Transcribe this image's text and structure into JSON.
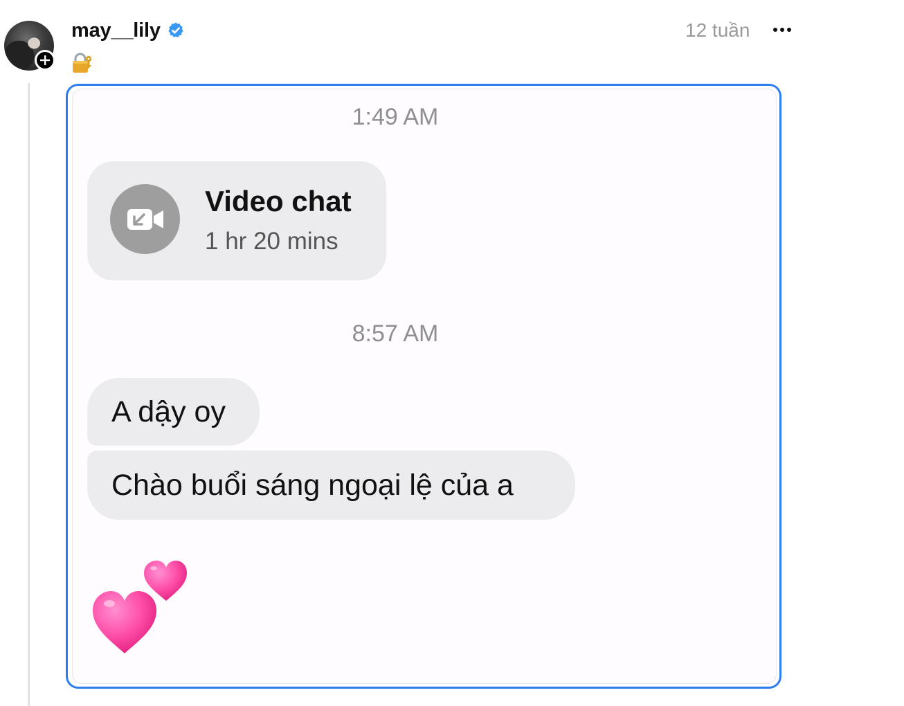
{
  "post": {
    "username": "may__lily",
    "caption_emoji": "🔐",
    "time_ago": "12 tuần",
    "more_label": "More options"
  },
  "image": {
    "messages": [
      {
        "type": "time",
        "text": "1:49 AM"
      },
      {
        "type": "call",
        "title": "Video chat",
        "duration": "1 hr 20 mins"
      },
      {
        "type": "time",
        "text": "8:57 AM"
      },
      {
        "type": "text",
        "text": "A dậy oy"
      },
      {
        "type": "text",
        "text": "Chào buổi sáng ngoại lệ của a"
      },
      {
        "type": "emoji",
        "icon": "two-hearts-icon",
        "text": "💕"
      }
    ]
  },
  "colors": {
    "verified": "#3897f0",
    "frame_border": "#2c7ef0",
    "bubble": "#ececef",
    "heart": "#ff4fa8"
  }
}
